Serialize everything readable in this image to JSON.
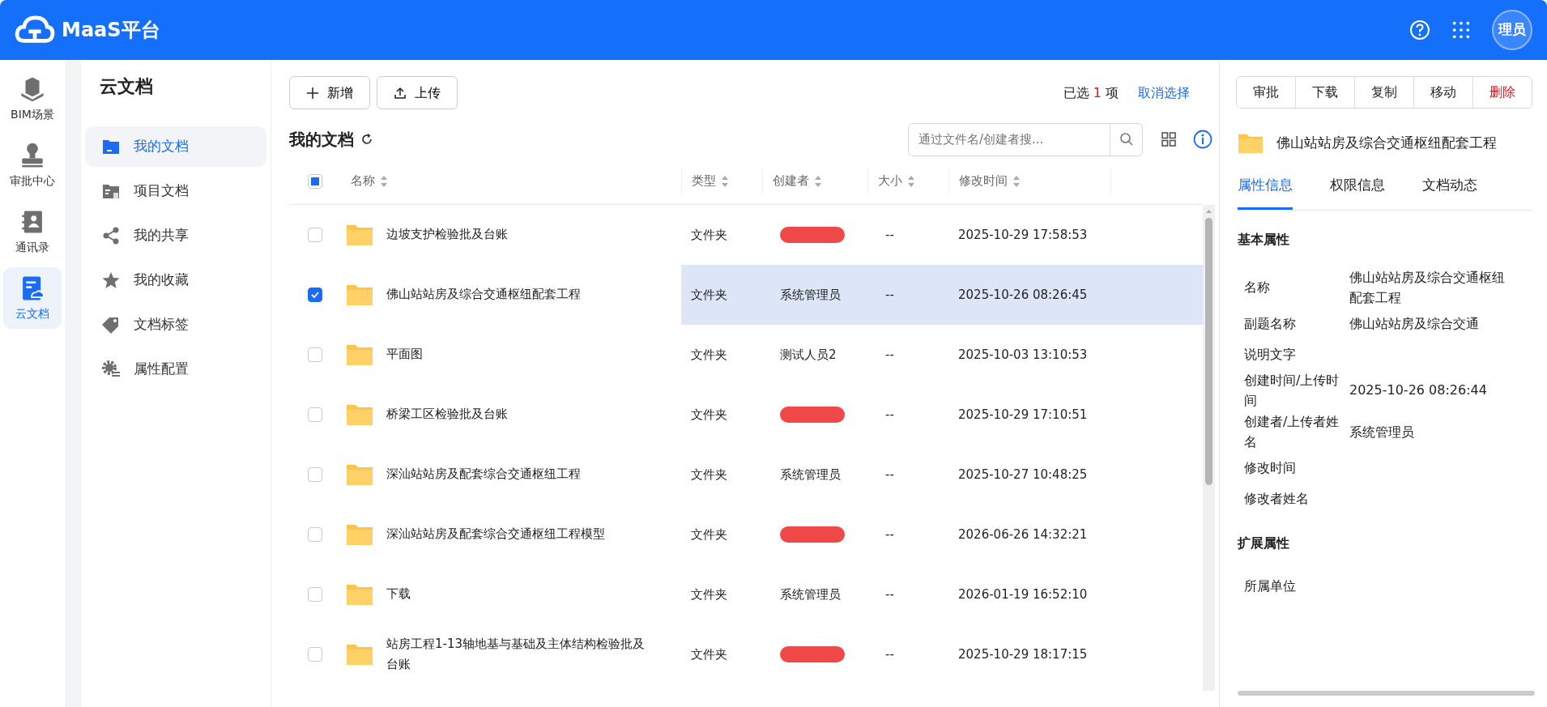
{
  "app": {
    "title": "MaaS平台"
  },
  "header": {
    "avatar": "理员"
  },
  "rail": [
    {
      "label": "BIM场景",
      "selected": false
    },
    {
      "label": "审批中心",
      "selected": false
    },
    {
      "label": "通讯录",
      "selected": false
    },
    {
      "label": "云文档",
      "selected": true
    }
  ],
  "nav": {
    "title": "云文档",
    "items": [
      {
        "label": "我的文档",
        "selected": true
      },
      {
        "label": "项目文档",
        "selected": false
      },
      {
        "label": "我的共享",
        "selected": false
      },
      {
        "label": "我的收藏",
        "selected": false
      },
      {
        "label": "文档标签",
        "selected": false
      },
      {
        "label": "属性配置",
        "selected": false
      }
    ]
  },
  "toolbar": {
    "buttons": [
      "新增",
      "上传"
    ],
    "selection": {
      "prefix": "已选",
      "count": "1",
      "suffix": "项"
    },
    "clear": "取消选择",
    "actions": [
      {
        "label": "审批",
        "danger": false
      },
      {
        "label": "下载",
        "danger": false
      },
      {
        "label": "复制",
        "danger": false
      },
      {
        "label": "移动",
        "danger": false
      },
      {
        "label": "删除",
        "danger": true
      }
    ]
  },
  "list": {
    "title": "我的文档",
    "search": {
      "placeholder": "通过文件名/创建者搜..."
    },
    "select_all_indeterminate": true,
    "columns": [
      "名称",
      "类型",
      "创建者",
      "大小",
      "修改时间"
    ],
    "rows": [
      {
        "name": "边坡支护检验批及台账",
        "type": "文件夹",
        "redacted": true,
        "size": "--",
        "modified": "2025-10-29 17:58:53",
        "selected": false
      },
      {
        "name": "佛山站站房及综合交通枢纽配套工程",
        "type": "文件夹",
        "creator": "系统管理员",
        "redacted": false,
        "size": "--",
        "modified": "2025-10-26 08:26:45",
        "selected": true
      },
      {
        "name": "平面图",
        "type": "文件夹",
        "creator": "测试人员2",
        "redacted": false,
        "size": "--",
        "modified": "2025-10-03 13:10:53",
        "selected": false
      },
      {
        "name": "桥梁工区检验批及台账",
        "type": "文件夹",
        "redacted": true,
        "size": "--",
        "modified": "2025-10-29 17:10:51",
        "selected": false
      },
      {
        "name": "深汕站站房及配套综合交通枢纽工程",
        "type": "文件夹",
        "creator": "系统管理员",
        "redacted": false,
        "size": "--",
        "modified": "2025-10-27 10:48:25",
        "selected": false
      },
      {
        "name": "深汕站站房及配套综合交通枢纽工程模型",
        "type": "文件夹",
        "redacted": true,
        "size": "--",
        "modified": "2026-06-26 14:32:21",
        "selected": false
      },
      {
        "name": "下载",
        "type": "文件夹",
        "creator": "系统管理员",
        "redacted": false,
        "size": "--",
        "modified": "2026-01-19 16:52:10",
        "selected": false
      },
      {
        "name": "站房工程1-13轴地基与基础及主体结构检验批及台账",
        "type": "文件夹",
        "redacted": true,
        "size": "--",
        "modified": "2025-10-29 18:17:15",
        "selected": false
      }
    ]
  },
  "details": {
    "title": "佛山站站房及综合交通枢纽配套工程",
    "tabs": [
      {
        "label": "属性信息",
        "selected": true
      },
      {
        "label": "权限信息",
        "selected": false
      },
      {
        "label": "文档动态",
        "selected": false
      }
    ],
    "sections": [
      {
        "title": "基本属性",
        "fields": [
          {
            "label": "名称",
            "value": "佛山站站房及综合交通枢纽配套工程"
          },
          {
            "label": "副题名称",
            "value": "佛山站站房及综合交通"
          },
          {
            "label": "说明文字"
          },
          {
            "label": "创建时间/上传时间",
            "value": "2025-10-26 08:26:44"
          },
          {
            "label": "创建者/上传者姓名",
            "value": "系统管理员"
          },
          {
            "label": "修改时间"
          },
          {
            "label": "修改者姓名"
          }
        ]
      },
      {
        "title": "扩展属性",
        "fields": [
          {
            "label": "所属单位"
          }
        ]
      }
    ]
  }
}
